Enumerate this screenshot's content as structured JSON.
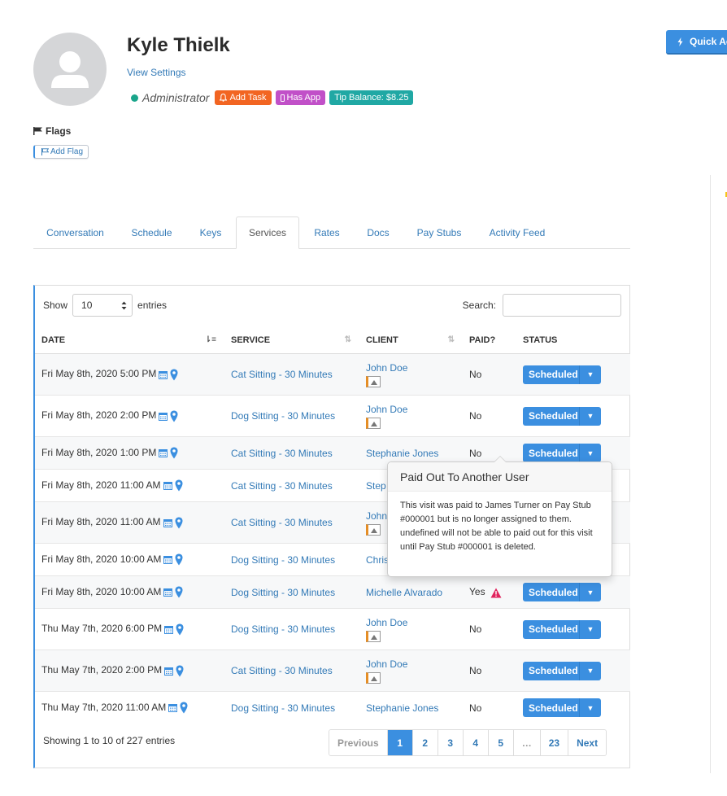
{
  "header": {
    "name": "Kyle Thielk",
    "view_settings": "View Settings",
    "role": "Administrator",
    "badges": {
      "add_task": "Add Task",
      "has_app": "Has App",
      "tip_balance": "Tip Balance: $8.25"
    },
    "quick_action": "Quick Ac"
  },
  "flags": {
    "title": "Flags",
    "add_flag": "Add Flag"
  },
  "tabs": [
    "Conversation",
    "Schedule",
    "Keys",
    "Services",
    "Rates",
    "Docs",
    "Pay Stubs",
    "Activity Feed"
  ],
  "active_tab": "Services",
  "table_controls": {
    "show": "Show",
    "entries_value": "10",
    "entries": "entries",
    "search_label": "Search:"
  },
  "columns": {
    "date": "DATE",
    "service": "SERVICE",
    "client": "CLIENT",
    "paid": "PAID?",
    "status": "STATUS"
  },
  "rows": [
    {
      "date": "Fri May 8th, 2020 5:00 PM",
      "service": "Cat Sitting - 30 Minutes",
      "client": "John Doe",
      "paid": "No",
      "status": "Scheduled"
    },
    {
      "date": "Fri May 8th, 2020 2:00 PM",
      "service": "Dog Sitting - 30 Minutes",
      "client": "John Doe",
      "paid": "No",
      "status": "Scheduled"
    },
    {
      "date": "Fri May 8th, 2020 1:00 PM",
      "service": "Cat Sitting - 30 Minutes",
      "client": "Stephanie Jones",
      "paid": "No",
      "status": "Scheduled"
    },
    {
      "date": "Fri May 8th, 2020 11:00 AM",
      "service": "Cat Sitting - 30 Minutes",
      "client": "Step",
      "paid": "",
      "status": ""
    },
    {
      "date": "Fri May 8th, 2020 11:00 AM",
      "service": "Cat Sitting - 30 Minutes",
      "client": "John",
      "paid": "",
      "status": ""
    },
    {
      "date": "Fri May 8th, 2020 10:00 AM",
      "service": "Dog Sitting - 30 Minutes",
      "client": "Chris",
      "paid": "",
      "status": ""
    },
    {
      "date": "Fri May 8th, 2020 10:00 AM",
      "service": "Dog Sitting - 30 Minutes",
      "client": "Michelle Alvarado",
      "paid": "Yes",
      "status": "Scheduled"
    },
    {
      "date": "Thu May 7th, 2020 6:00 PM",
      "service": "Dog Sitting - 30 Minutes",
      "client": "John Doe",
      "paid": "No",
      "status": "Scheduled"
    },
    {
      "date": "Thu May 7th, 2020 2:00 PM",
      "service": "Cat Sitting - 30 Minutes",
      "client": "John Doe",
      "paid": "No",
      "status": "Scheduled"
    },
    {
      "date": "Thu May 7th, 2020 11:00 AM",
      "service": "Dog Sitting - 30 Minutes",
      "client": "Stephanie Jones",
      "paid": "No",
      "status": "Scheduled"
    }
  ],
  "footer": {
    "info": "Showing 1 to 10 of 227 entries",
    "pages": [
      "Previous",
      "1",
      "2",
      "3",
      "4",
      "5",
      "…",
      "23",
      "Next"
    ],
    "current_page": "1"
  },
  "popover": {
    "title": "Paid Out To Another User",
    "body": "This visit was paid to James Turner on Pay Stub #000001 but is no longer assigned to them. undefined will not be able to paid out for this visit until Pay Stub #000001 is deleted."
  },
  "colors": {
    "primary": "#3b8fe0",
    "orange": "#f26522",
    "purple": "#c150c8",
    "teal": "#20a8a4",
    "online": "#1aa58b",
    "warning": "#e0245e"
  },
  "icons": {
    "calendar": "calendar-icon",
    "location": "map-marker-icon",
    "flag": "flag-icon",
    "bell": "bell-icon",
    "phone": "mobile-icon",
    "bolt": "bolt-icon",
    "warning": "warning-icon"
  }
}
